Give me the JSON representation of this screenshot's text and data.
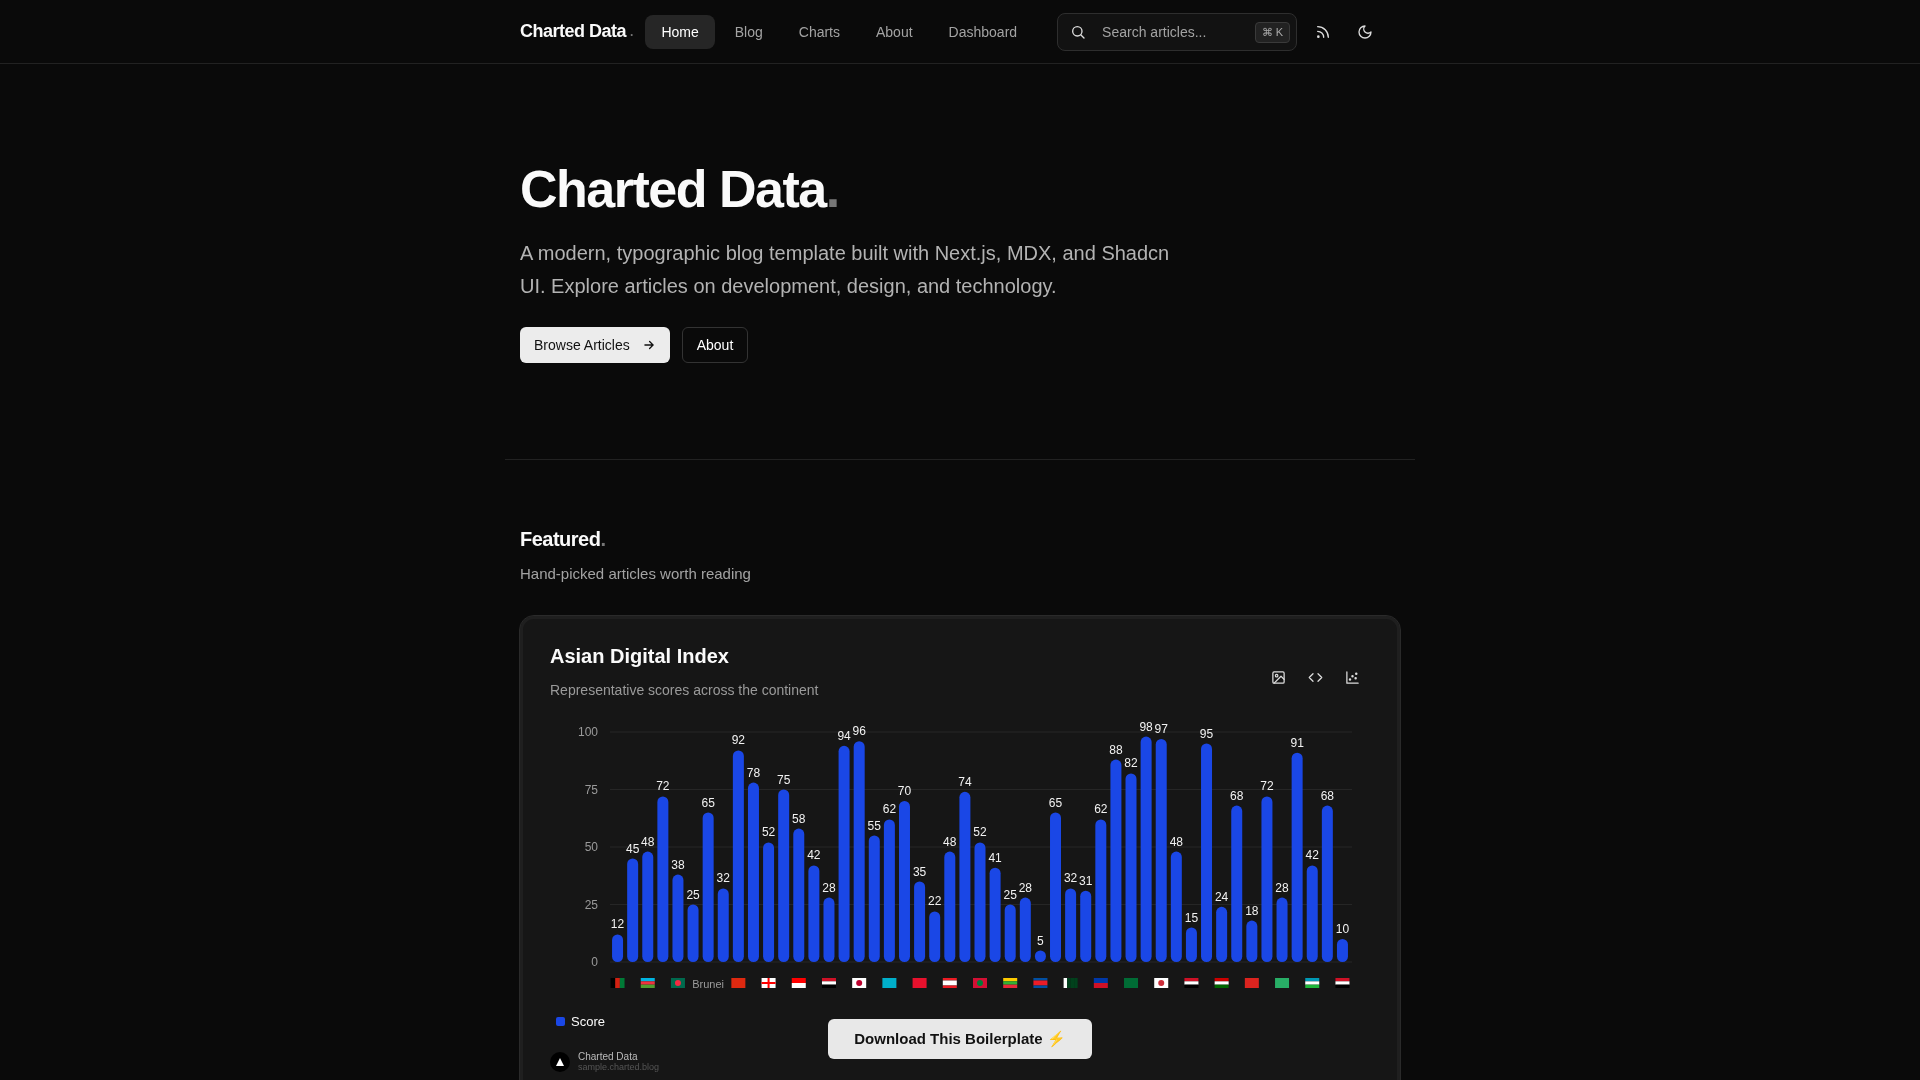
{
  "nav": {
    "brand": "Charted Data",
    "brand_mark": ".",
    "links": [
      {
        "label": "Home",
        "selected": true
      },
      {
        "label": "Blog",
        "selected": false
      },
      {
        "label": "Charts",
        "selected": false
      },
      {
        "label": "About",
        "selected": false
      },
      {
        "label": "Dashboard",
        "selected": false
      }
    ],
    "search": {
      "placeholder": "Search articles...",
      "shortcut": "⌘ K"
    }
  },
  "hero": {
    "title": "Charted Data",
    "title_mark": ".",
    "description": "A modern, typographic blog template built with Next.js, MDX, and Shadcn UI. Explore articles on development, design, and technology.",
    "buttons": [
      {
        "label": "Browse Articles",
        "kind": "primary"
      },
      {
        "label": "About",
        "kind": "outline"
      }
    ]
  },
  "featured": {
    "title": "Featured",
    "title_mark": ".",
    "subtitle": "Hand-picked articles worth reading",
    "card": {
      "title": "Asian Digital Index",
      "subtitle": "Representative scores across the continent",
      "chart_data": {
        "type": "bar",
        "series": [
          {
            "name": "Score",
            "color": "#1a47e6",
            "values": [
              12,
              45,
              48,
              72,
              38,
              25,
              65,
              32,
              92,
              78,
              52,
              75,
              58,
              42,
              28,
              94,
              96,
              55,
              62,
              70,
              35,
              22,
              48,
              74,
              52,
              41,
              25,
              28,
              5,
              65,
              32,
              31,
              62,
              88,
              82,
              98,
              97,
              48,
              15,
              95,
              24,
              68,
              18,
              72,
              28,
              91,
              42,
              68,
              10
            ]
          }
        ],
        "ylim": [
          0,
          100
        ],
        "yticks": [
          0,
          25,
          50,
          75,
          100
        ],
        "grid": true,
        "data_labels": true
      },
      "x_labels": [
        {
          "kind": "flag"
        },
        {
          "kind": "flag"
        },
        {
          "kind": "flag"
        },
        {
          "kind": "text",
          "text": "Brunei"
        },
        {
          "kind": "flag"
        },
        {
          "kind": "flag"
        },
        {
          "kind": "flag"
        },
        {
          "kind": "flag"
        },
        {
          "kind": "flag"
        },
        {
          "kind": "flag"
        },
        {
          "kind": "flag"
        },
        {
          "kind": "flag"
        },
        {
          "kind": "flag"
        },
        {
          "kind": "flag"
        },
        {
          "kind": "flag"
        },
        {
          "kind": "flag"
        },
        {
          "kind": "flag"
        },
        {
          "kind": "flag"
        },
        {
          "kind": "flag"
        },
        {
          "kind": "flag"
        },
        {
          "kind": "flag"
        },
        {
          "kind": "flag"
        },
        {
          "kind": "flag"
        },
        {
          "kind": "flag"
        },
        {
          "kind": "flag"
        }
      ],
      "download": "Download This Boilerplate ⚡",
      "site_name": "Charted Data",
      "site_url": "sample.charted.blog"
    }
  }
}
